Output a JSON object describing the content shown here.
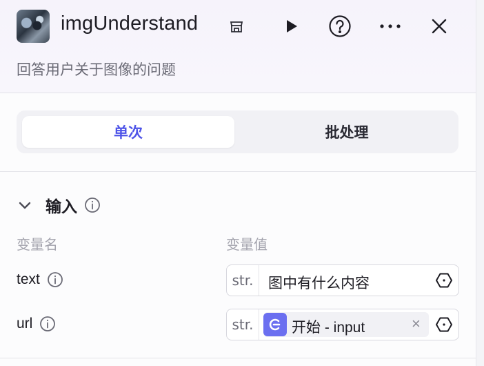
{
  "header": {
    "title": "imgUnderstand",
    "subtitle": "回答用户关于图像的问题",
    "icons": [
      "store-icon",
      "play-icon",
      "help-icon",
      "more-icon",
      "close-icon"
    ]
  },
  "tabs": [
    {
      "label": "单次",
      "active": true
    },
    {
      "label": "批处理",
      "active": false
    }
  ],
  "inputs": {
    "section_title": "输入",
    "col_name": "变量名",
    "col_value": "变量值",
    "rows": [
      {
        "name": "text",
        "type": "str.",
        "value": "图中有什么内容"
      },
      {
        "name": "url",
        "type": "str.",
        "ref_label": "开始 - input"
      }
    ]
  },
  "colors": {
    "accent": "#4d53e8",
    "chip_icon": "#6b6ff0"
  }
}
